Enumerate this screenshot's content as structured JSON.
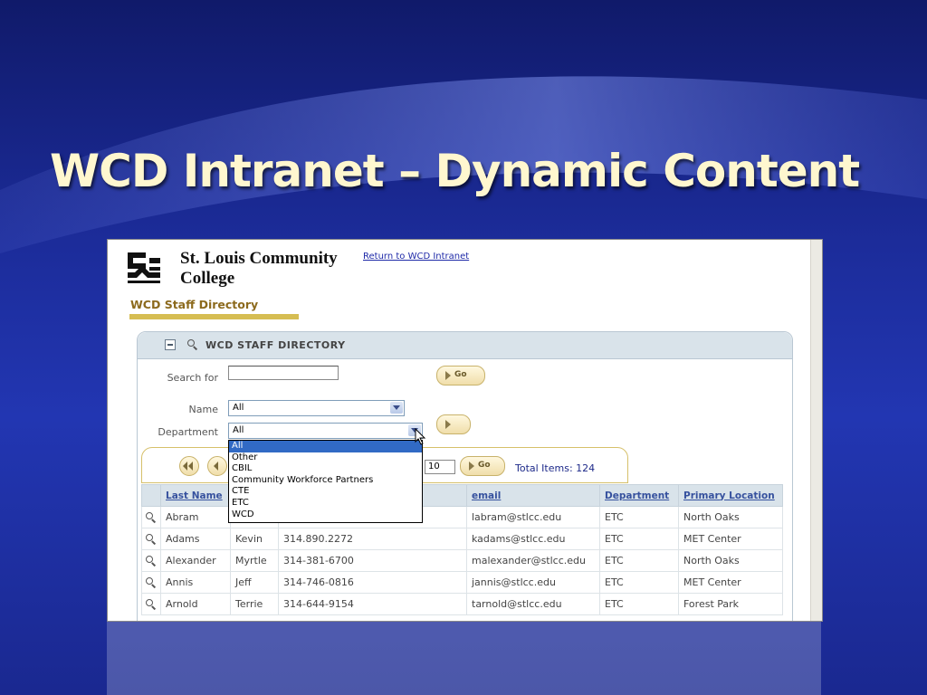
{
  "slide": {
    "title": "WCD Intranet – Dynamic Content"
  },
  "header": {
    "college_line1": "St. Louis Community",
    "college_line2": "College",
    "return_link": "Return to WCD Intranet",
    "directory_heading": "WCD Staff Directory"
  },
  "panel": {
    "title": "WCD STAFF DIRECTORY"
  },
  "search": {
    "search_label": "Search for",
    "search_value": "",
    "go_label": "Go",
    "name_label": "Name",
    "name_value": "All",
    "department_label": "Department",
    "department_value": "All"
  },
  "department_options": [
    "All",
    "Other",
    "CBIL",
    "Community Workforce Partners",
    "CTE",
    "ETC",
    "WCD"
  ],
  "pager": {
    "page_size": "10",
    "go_label": "Go",
    "total": "Total Items: 124"
  },
  "table": {
    "columns": [
      "Last Name",
      "",
      "",
      "email",
      "Department",
      "Primary Location"
    ],
    "rows": [
      {
        "last": "Abram",
        "first": "",
        "phone": "",
        "email": "labram@stlcc.edu",
        "dept": "ETC",
        "location": "North Oaks"
      },
      {
        "last": "Adams",
        "first": "Kevin",
        "phone": "314.890.2272",
        "email": "kadams@stlcc.edu",
        "dept": "ETC",
        "location": "MET Center"
      },
      {
        "last": "Alexander",
        "first": "Myrtle",
        "phone": "314-381-6700",
        "email": "malexander@stlcc.edu",
        "dept": "ETC",
        "location": "North Oaks"
      },
      {
        "last": "Annis",
        "first": "Jeff",
        "phone": "314-746-0816",
        "email": "jannis@stlcc.edu",
        "dept": "ETC",
        "location": "MET Center"
      },
      {
        "last": "Arnold",
        "first": "Terrie",
        "phone": "314-644-9154",
        "email": "tarnold@stlcc.edu",
        "dept": "ETC",
        "location": "Forest Park"
      }
    ]
  },
  "colors": {
    "title": "#fff7cf",
    "gold": "#d6bd52",
    "highlight": "#316ac5",
    "link": "#1f2aa8"
  }
}
